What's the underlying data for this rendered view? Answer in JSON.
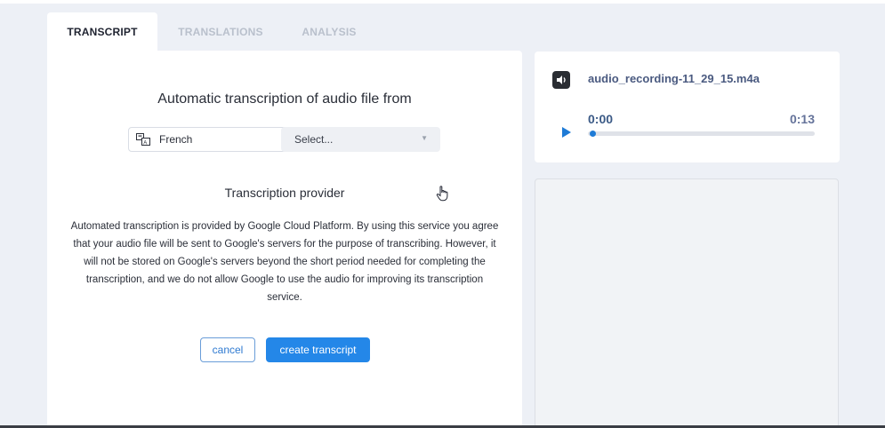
{
  "tabs": [
    {
      "label": "TRANSCRIPT",
      "active": true
    },
    {
      "label": "TRANSLATIONS",
      "active": false
    },
    {
      "label": "ANALYSIS",
      "active": false
    }
  ],
  "transcript": {
    "headline": "Automatic transcription of audio file from",
    "language": {
      "value": "French",
      "icon": "translate-icon",
      "clear_icon": "close-icon"
    },
    "dialect_select": {
      "placeholder": "Select...",
      "icon": "caret-down-icon"
    },
    "provider_title": "Transcription provider",
    "disclaimer": "Automated transcription is provided by Google Cloud Platform. By using this service you agree that your audio file will be sent to Google's servers for the purpose of transcribing. However, it will not be stored on Google's servers beyond the short period needed for completing the transcription, and we do not allow Google to use the audio for improving its transcription service.",
    "cancel_label": "cancel",
    "create_label": "create transcript"
  },
  "audio": {
    "file_icon": "audio-file-icon",
    "file_name": "audio_recording-11_29_15.m4a",
    "current_time": "0:00",
    "total_time": "0:13",
    "progress": 0.0,
    "play_icon": "play-icon"
  },
  "colors": {
    "accent": "#2487e8",
    "background": "#edf0f6",
    "time_text": "#3b5a86"
  }
}
